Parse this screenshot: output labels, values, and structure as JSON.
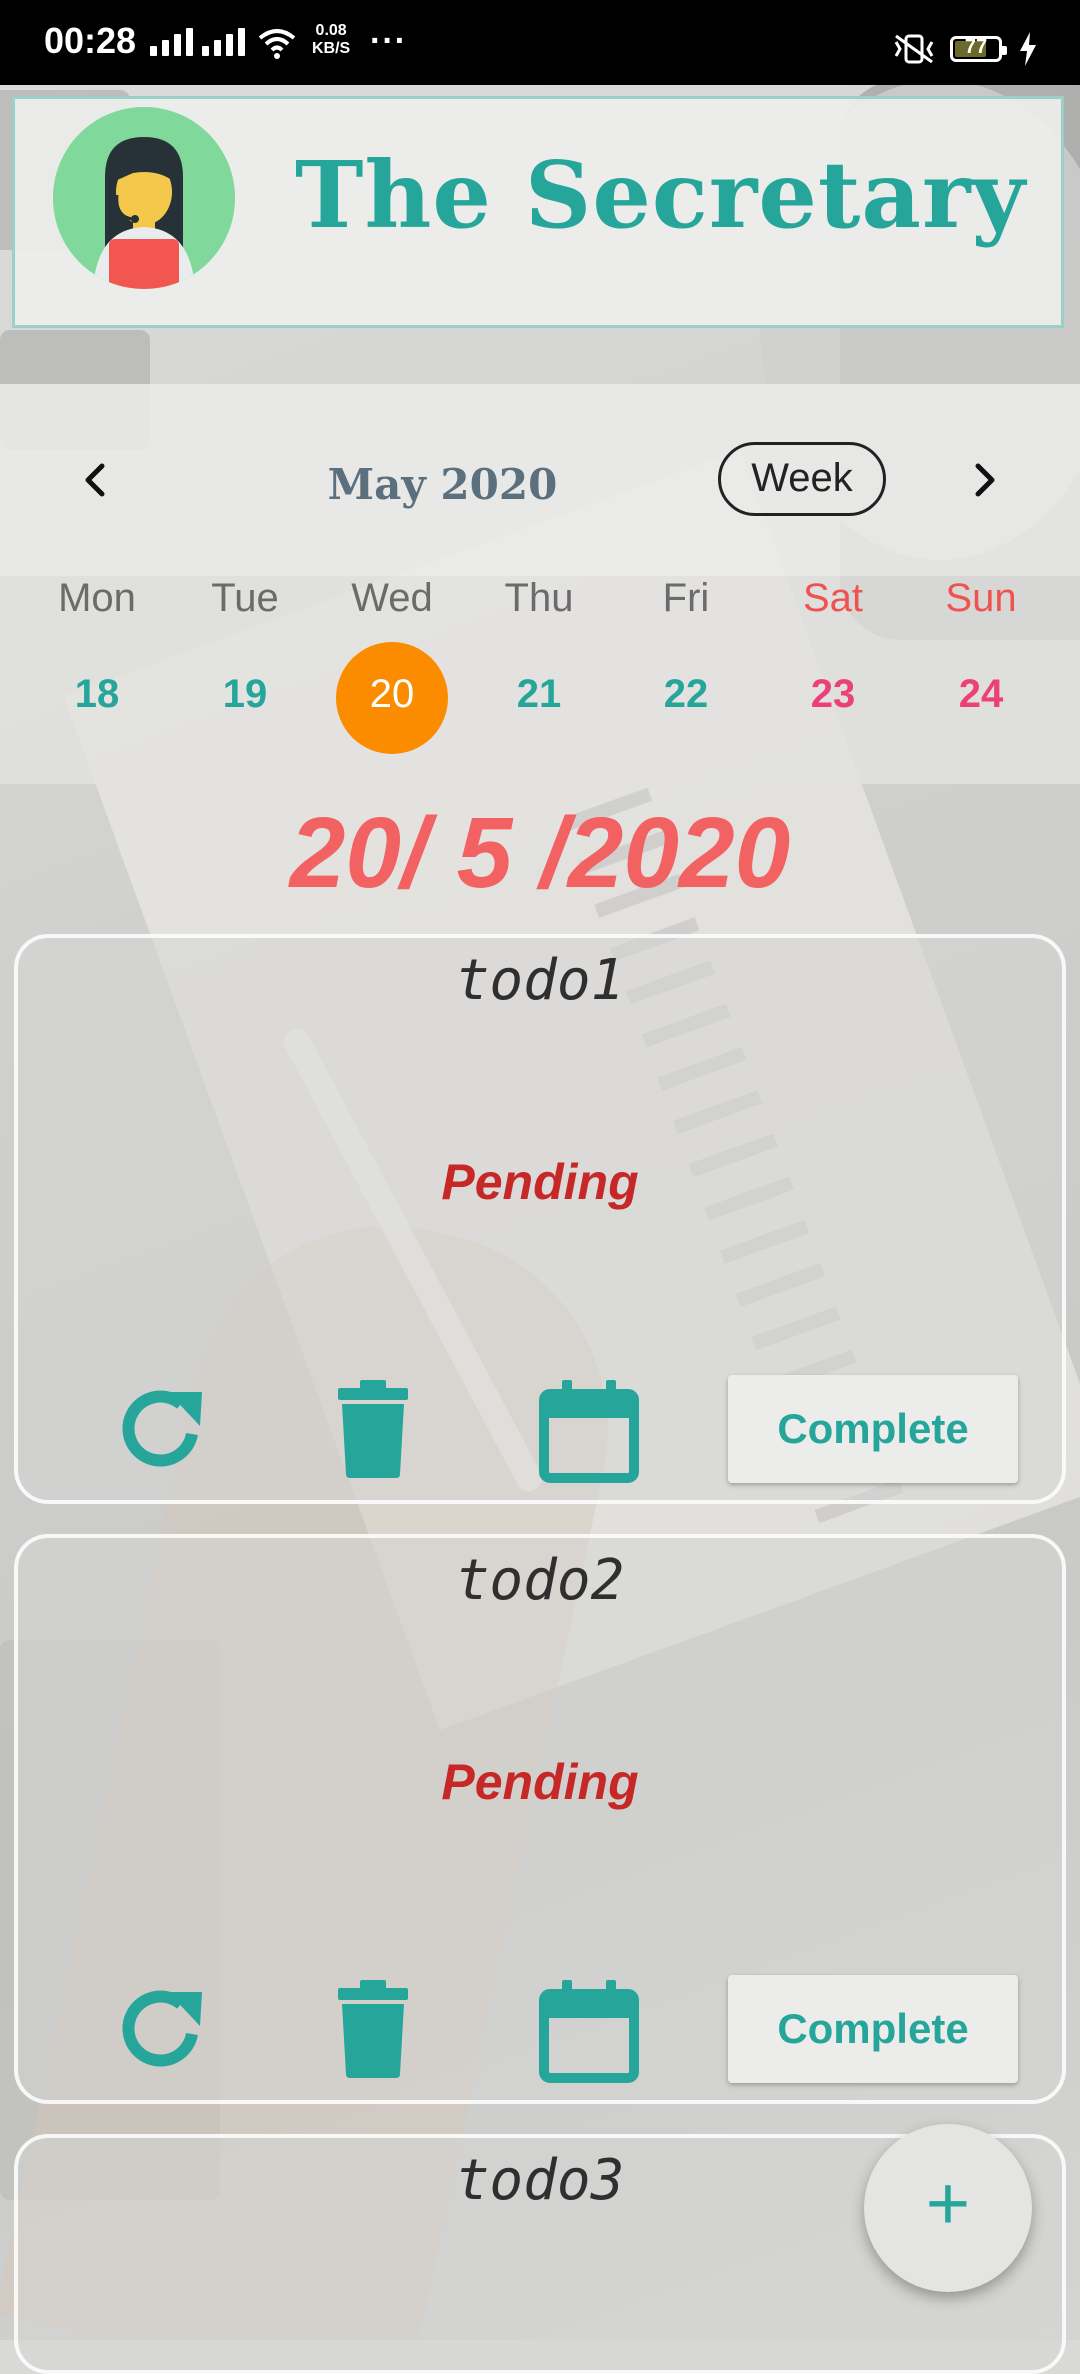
{
  "status_bar": {
    "time": "00:28",
    "net_speed_value": "0.08",
    "net_speed_unit": "KB/S",
    "overflow": "···",
    "battery_percent": "77",
    "battery_level": 0.77
  },
  "app": {
    "title": "The Secretary",
    "avatar_icon": "secretary-avatar-icon",
    "accent_color": "#26a69a"
  },
  "calendar": {
    "month_label": "May 2020",
    "view_button": "Week",
    "prev_icon": "chevron-left-icon",
    "next_icon": "chevron-right-icon",
    "days": [
      {
        "dow": "Mon",
        "date": "18"
      },
      {
        "dow": "Tue",
        "date": "19"
      },
      {
        "dow": "Wed",
        "date": "20"
      },
      {
        "dow": "Thu",
        "date": "21"
      },
      {
        "dow": "Fri",
        "date": "22"
      },
      {
        "dow": "Sat",
        "date": "23"
      },
      {
        "dow": "Sun",
        "date": "24"
      }
    ],
    "selected_date": "20",
    "selected_color": "#fb8c00"
  },
  "selected_date_display": "20/ 5 /2020",
  "todos": [
    {
      "title": "todo1",
      "status": "Pending",
      "complete_label": "Complete"
    },
    {
      "title": "todo2",
      "status": "Pending",
      "complete_label": "Complete"
    },
    {
      "title": "todo3"
    }
  ],
  "todo_actions": {
    "refresh_icon": "refresh-icon",
    "delete_icon": "trash-icon",
    "calendar_icon": "calendar-icon"
  },
  "fab": {
    "label": "+",
    "icon": "plus-icon"
  }
}
